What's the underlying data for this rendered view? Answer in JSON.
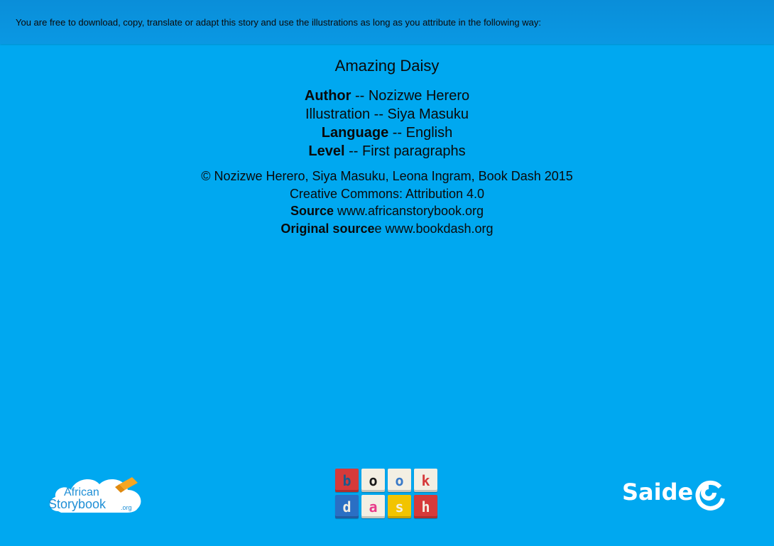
{
  "banner": {
    "text": "You are free to download, copy, translate or adapt this story and use the illustrations as long as you attribute in the following way:"
  },
  "story": {
    "title": "Amazing  Daisy"
  },
  "meta": {
    "author_label": "Author",
    "author_value": " -- Nozizwe Herero",
    "illustration_text": "Illustration -- Siya Masuku",
    "language_label": "Language",
    "language_value": " -- English",
    "level_label": "Level",
    "level_value": " -- First paragraphs"
  },
  "license": {
    "copyright": "© Nozizwe Herero, Siya Masuku, Leona Ingram, Book Dash 2015",
    "cc": "Creative Commons: Attribution 4.0",
    "source_label": "Source",
    "source_value": " www.africanstorybook.org",
    "original_label": "Original source",
    "original_value": "e www.bookdash.org"
  },
  "logos": {
    "asb_line1": "African",
    "asb_line2": "Storybook",
    "asb_suffix": ".org",
    "bookdash_tiles": [
      {
        "letter": "b",
        "bg": "#d63a3a",
        "fg": "#1e5a8a"
      },
      {
        "letter": "o",
        "bg": "#f3efe3",
        "fg": "#1a1a1a"
      },
      {
        "letter": "o",
        "bg": "#f3efe3",
        "fg": "#3a7ac8"
      },
      {
        "letter": "k",
        "bg": "#f3efe3",
        "fg": "#d63a3a"
      },
      {
        "letter": "d",
        "bg": "#2a6fc4",
        "fg": "#f3efe3"
      },
      {
        "letter": "a",
        "bg": "#f3efe3",
        "fg": "#e83a8a"
      },
      {
        "letter": "s",
        "bg": "#f2c400",
        "fg": "#f3efe3"
      },
      {
        "letter": "h",
        "bg": "#d63a3a",
        "fg": "#f3efe3"
      }
    ],
    "saide": "Saide"
  },
  "colors": {
    "background": "#00a8f0",
    "banner": "#0a92dd"
  }
}
